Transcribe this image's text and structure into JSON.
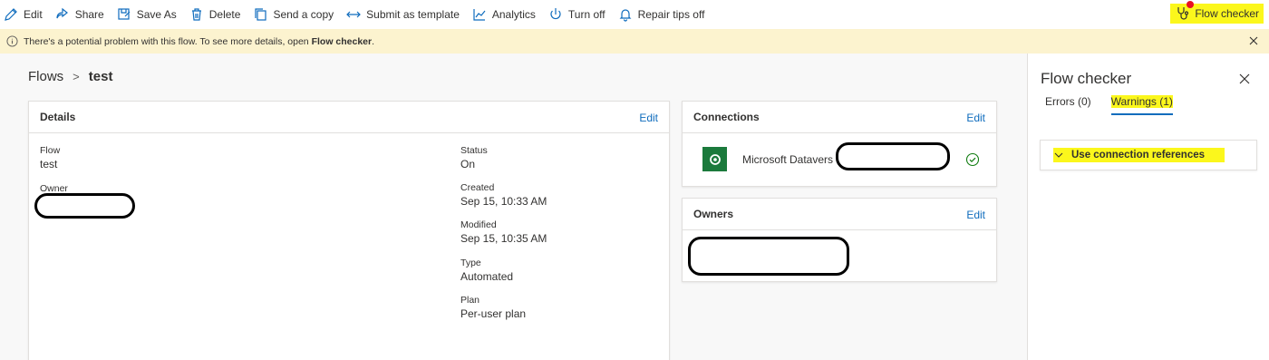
{
  "command_bar": {
    "items": [
      {
        "label": "Edit",
        "icon": "pencil-icon"
      },
      {
        "label": "Share",
        "icon": "share-icon"
      },
      {
        "label": "Save As",
        "icon": "save-as-icon"
      },
      {
        "label": "Delete",
        "icon": "trash-icon"
      },
      {
        "label": "Send a copy",
        "icon": "copy-icon"
      },
      {
        "label": "Submit as template",
        "icon": "arrows-icon"
      },
      {
        "label": "Analytics",
        "icon": "chart-icon"
      },
      {
        "label": "Turn off",
        "icon": "power-icon"
      },
      {
        "label": "Repair tips off",
        "icon": "bell-icon"
      }
    ],
    "flow_checker_label": "Flow checker"
  },
  "warning_bar": {
    "message_prefix": "There's a potential problem with this flow. To see more details, open ",
    "message_link": "Flow checker",
    "message_suffix": "."
  },
  "breadcrumb": {
    "parent": "Flows",
    "current": "test"
  },
  "details_card": {
    "title": "Details",
    "edit_label": "Edit",
    "flow_key": "Flow",
    "flow_value": "test",
    "owner_key": "Owner",
    "status_key": "Status",
    "status_value": "On",
    "created_key": "Created",
    "created_value": "Sep 15, 10:33 AM",
    "modified_key": "Modified",
    "modified_value": "Sep 15, 10:35 AM",
    "type_key": "Type",
    "type_value": "Automated",
    "plan_key": "Plan",
    "plan_value": "Per-user plan"
  },
  "connections_card": {
    "title": "Connections",
    "edit_label": "Edit",
    "connection_name": "Microsoft Datavers"
  },
  "owners_card": {
    "title": "Owners",
    "edit_label": "Edit"
  },
  "flow_checker_panel": {
    "title": "Flow checker",
    "tabs": [
      {
        "label": "Errors (0)"
      },
      {
        "label": "Warnings (1)"
      }
    ],
    "warning_item": "Use connection references"
  },
  "colors": {
    "accent": "#0f6cbd",
    "highlight": "#fbf71c",
    "warning_bg": "#fcf3cf",
    "dataverse_green": "#1b7a3c"
  }
}
